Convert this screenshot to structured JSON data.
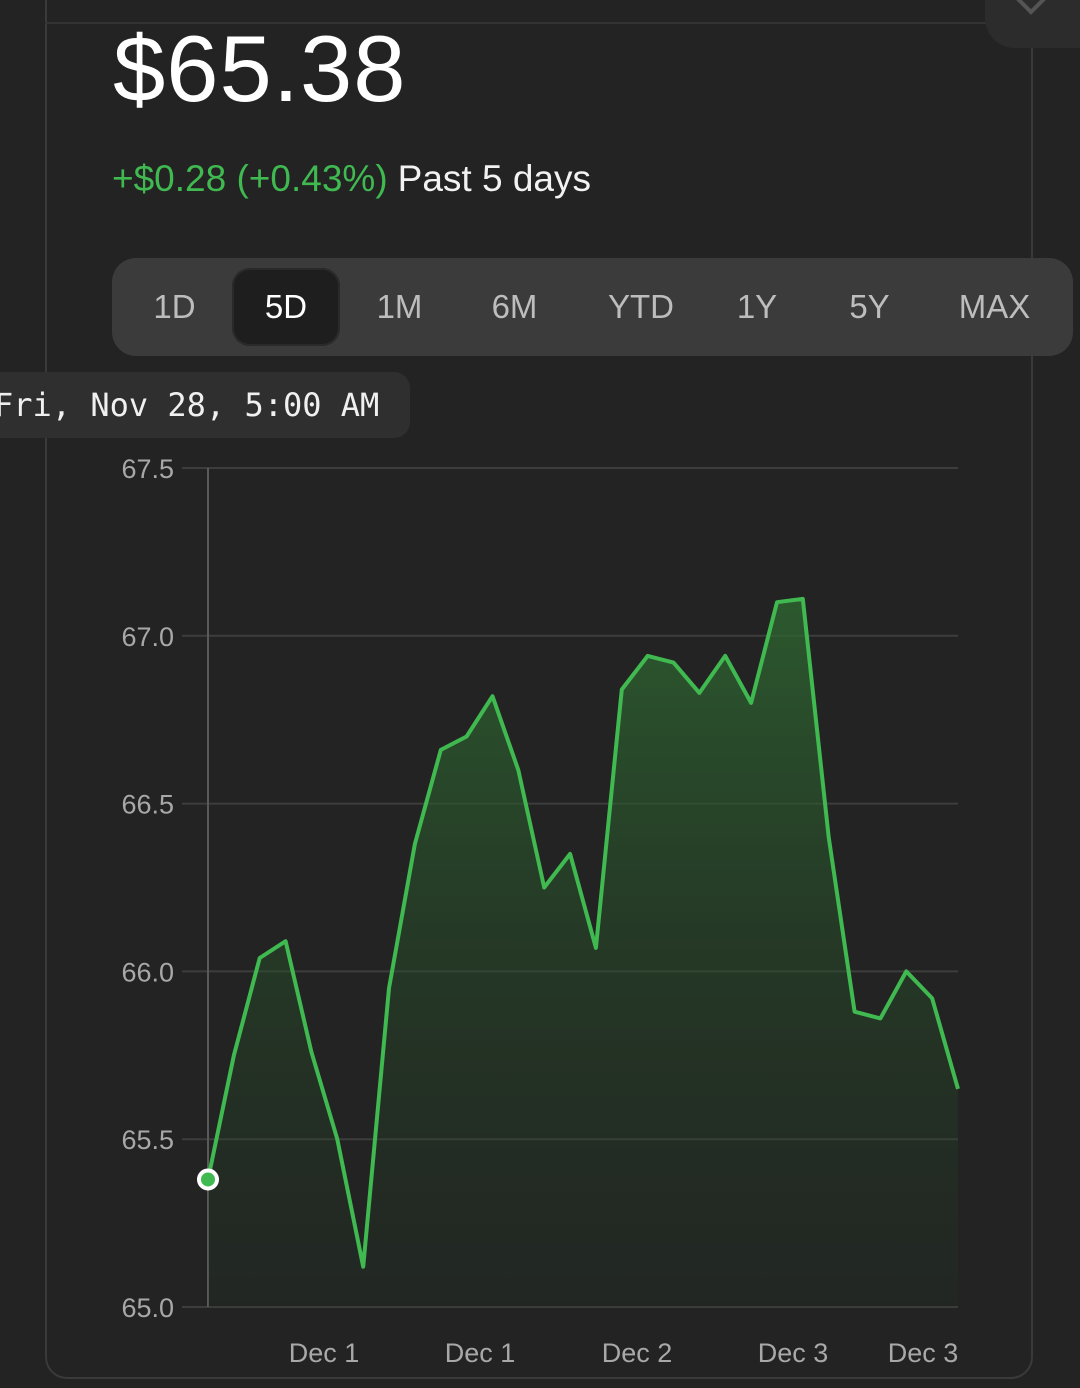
{
  "quote": {
    "price": "$65.38",
    "change": "+$0.28 (+0.43%)",
    "period_label": "Past 5 days"
  },
  "ranges": {
    "options": [
      "1D",
      "5D",
      "1M",
      "6M",
      "YTD",
      "1Y",
      "5Y",
      "MAX"
    ],
    "selected": "5D"
  },
  "tooltip": {
    "text": "Fri, Nov 28, 5:00 AM"
  },
  "colors": {
    "accent_green": "#3fb950",
    "background": "#232323"
  },
  "chart_data": {
    "type": "area",
    "ylim": [
      65.0,
      67.5
    ],
    "yticks": [
      "67.5",
      "67.0",
      "66.5",
      "66.0",
      "65.5",
      "65.0"
    ],
    "xticks": [
      "Dec 1",
      "Dec 1",
      "Dec 2",
      "Dec 3",
      "Dec 3"
    ],
    "grid": true,
    "series": [
      {
        "values": [
          65.38,
          65.75,
          66.04,
          66.09,
          65.76,
          65.5,
          65.12,
          65.95,
          66.38,
          66.66,
          66.7,
          66.82,
          66.6,
          66.25,
          66.35,
          66.07,
          66.84,
          66.94,
          66.92,
          66.83,
          66.94,
          66.8,
          67.1,
          67.11,
          66.4,
          65.88,
          65.86,
          66.0,
          65.92,
          65.65
        ]
      }
    ],
    "marker": {
      "index": 0,
      "value": 65.38
    }
  }
}
